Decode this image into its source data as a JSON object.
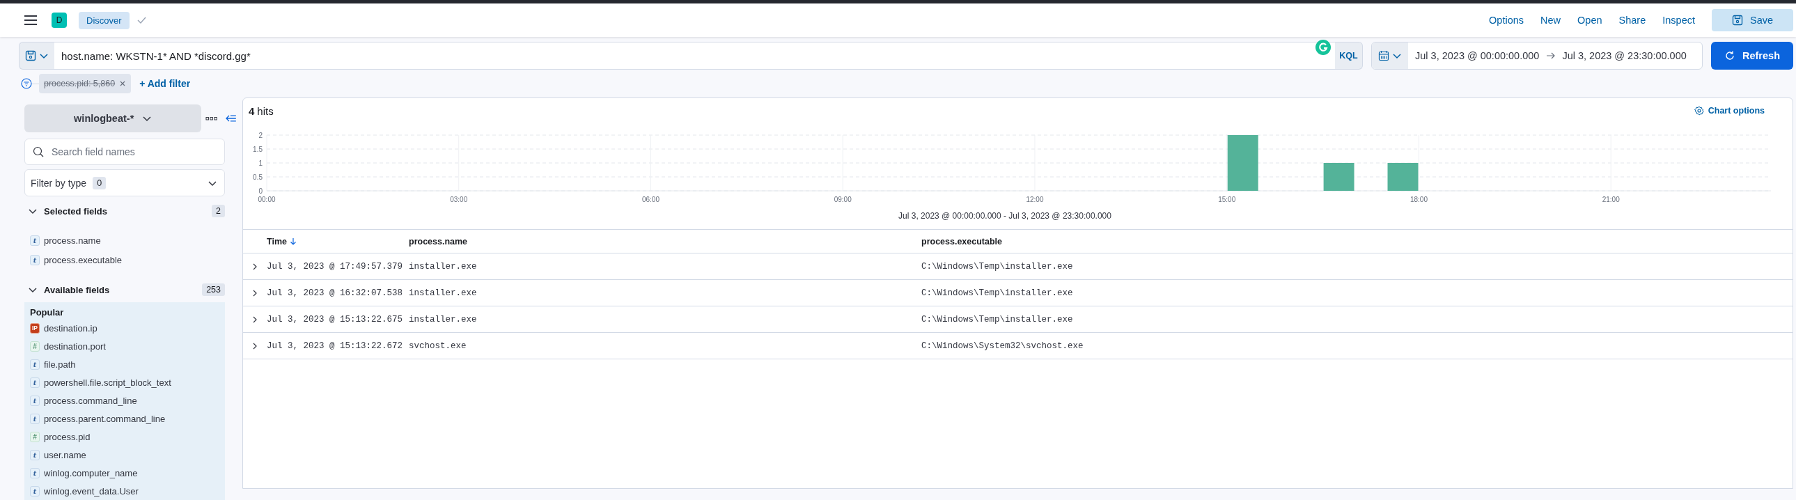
{
  "header": {
    "avatar": "D",
    "breadcrumb": "Discover",
    "nav_links": [
      "Options",
      "New",
      "Open",
      "Share",
      "Inspect"
    ],
    "save_button": "Save"
  },
  "query_bar": {
    "query": "host.name: WKSTN-1* AND *discord.gg*",
    "language": "KQL",
    "date_start": "Jul 3, 2023 @ 00:00:00.000",
    "date_end": "Jul 3, 2023 @ 23:30:00.000",
    "refresh_button": "Refresh"
  },
  "filters": [
    {
      "label": "process.pid: 5,860",
      "disabled": true
    }
  ],
  "add_filter": "+ Add filter",
  "sidebar": {
    "index_pattern": "winlogbeat-*",
    "search": {
      "placeholder": "Search field names"
    },
    "filter_by_type": {
      "label": "Filter by type",
      "count": "0"
    },
    "selected_fields": {
      "title": "Selected fields",
      "count": "2",
      "expanded": true,
      "items": [
        {
          "name": "process.name",
          "type": "t",
          "kind": "string"
        },
        {
          "name": "process.executable",
          "type": "t",
          "kind": "string"
        }
      ]
    },
    "available_fields": {
      "title": "Available fields",
      "count": "253",
      "expanded": true,
      "groups": [
        {
          "title": "Popular",
          "items": [
            {
              "name": "destination.ip",
              "type": "IP",
              "kind": "ip"
            },
            {
              "name": "destination.port",
              "type": "#",
              "kind": "number"
            },
            {
              "name": "file.path",
              "type": "t",
              "kind": "string"
            },
            {
              "name": "powershell.file.script_block_text",
              "type": "t",
              "kind": "string"
            },
            {
              "name": "process.command_line",
              "type": "t",
              "kind": "string"
            },
            {
              "name": "process.parent.command_line",
              "type": "t",
              "kind": "string"
            },
            {
              "name": "process.pid",
              "type": "#",
              "kind": "number"
            },
            {
              "name": "user.name",
              "type": "t",
              "kind": "string"
            },
            {
              "name": "winlog.computer_name",
              "type": "t",
              "kind": "string"
            },
            {
              "name": "winlog.event_data.User",
              "type": "t",
              "kind": "string"
            }
          ]
        }
      ]
    }
  },
  "results": {
    "hits_count": "4",
    "hits_label": "hits",
    "chart_options": "Chart options",
    "chart_data": {
      "type": "bar",
      "grid": true,
      "x": [
        15.25,
        16.75,
        17.75
      ],
      "values": [
        2,
        1,
        1
      ],
      "xlim": [
        0,
        23.5
      ],
      "ylim": [
        0,
        2
      ],
      "yticks": [
        0,
        0.5,
        1,
        1.5,
        2
      ],
      "xticks": [
        {
          "value": 0,
          "label": "00:00"
        },
        {
          "value": 3,
          "label": "03:00"
        },
        {
          "value": 6,
          "label": "06:00"
        },
        {
          "value": 9,
          "label": "09:00"
        },
        {
          "value": 12,
          "label": "12:00"
        },
        {
          "value": 15,
          "label": "15:00"
        },
        {
          "value": 18,
          "label": "18:00"
        },
        {
          "value": 21,
          "label": "21:00"
        }
      ],
      "xlabel": "Jul 3, 2023 @ 00:00:00.000 - Jul 3, 2023 @ 23:30:00.000"
    },
    "table": {
      "columns": [
        {
          "label": "Time",
          "sorted": true
        },
        {
          "label": "process.name",
          "sorted": false
        },
        {
          "label": "process.executable",
          "sorted": false
        }
      ],
      "rows": [
        [
          "Jul 3, 2023 @ 17:49:57.379",
          "installer.exe",
          "C:\\Windows\\Temp\\installer.exe"
        ],
        [
          "Jul 3, 2023 @ 16:32:07.538",
          "installer.exe",
          "C:\\Windows\\Temp\\installer.exe"
        ],
        [
          "Jul 3, 2023 @ 15:13:22.675",
          "installer.exe",
          "C:\\Windows\\Temp\\installer.exe"
        ],
        [
          "Jul 3, 2023 @ 15:13:22.672",
          "svchost.exe",
          "C:\\Windows\\System32\\svchost.exe"
        ]
      ]
    }
  }
}
